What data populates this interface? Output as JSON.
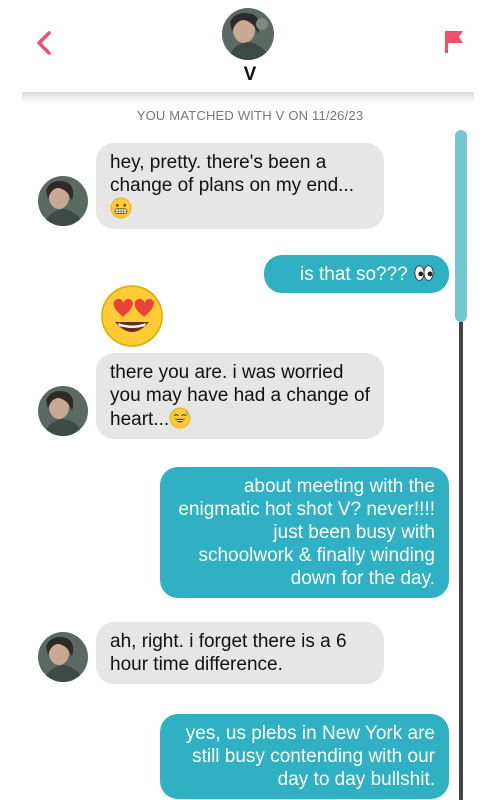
{
  "header": {
    "name": "V",
    "back_icon": "chevron-left-icon",
    "flag_icon": "flag-icon",
    "accent_color": "#f0506e"
  },
  "match_banner": "YOU MATCHED WITH V ON 11/26/23",
  "messages": [
    {
      "from": "them",
      "text": "hey, pretty. there's been a change of plans on my end...",
      "emoji": "grimacing-face-icon"
    },
    {
      "from": "me",
      "text": "is that so??? ",
      "emoji": "eyes-icon"
    },
    {
      "from": "them",
      "type": "emoji",
      "emoji": "heart-eyes-icon"
    },
    {
      "from": "them",
      "text": "there you are. i was worried you may have had a change of heart...",
      "emoji": "sweat-smile-icon"
    },
    {
      "from": "me",
      "text": "about meeting with the enigmatic hot shot V? never!!!! just been busy with schoolwork &  finally winding down for the day."
    },
    {
      "from": "them",
      "text": "ah, right. i forget there is a 6 hour time difference."
    },
    {
      "from": "me",
      "text": "yes, us plebs in New York are still busy contending with our day to day bullshit."
    }
  ],
  "colors": {
    "incoming_bubble": "#e6e6e6",
    "outgoing_bubble": "#2fb0c3",
    "scroll_thumb": "#74c6d1"
  }
}
